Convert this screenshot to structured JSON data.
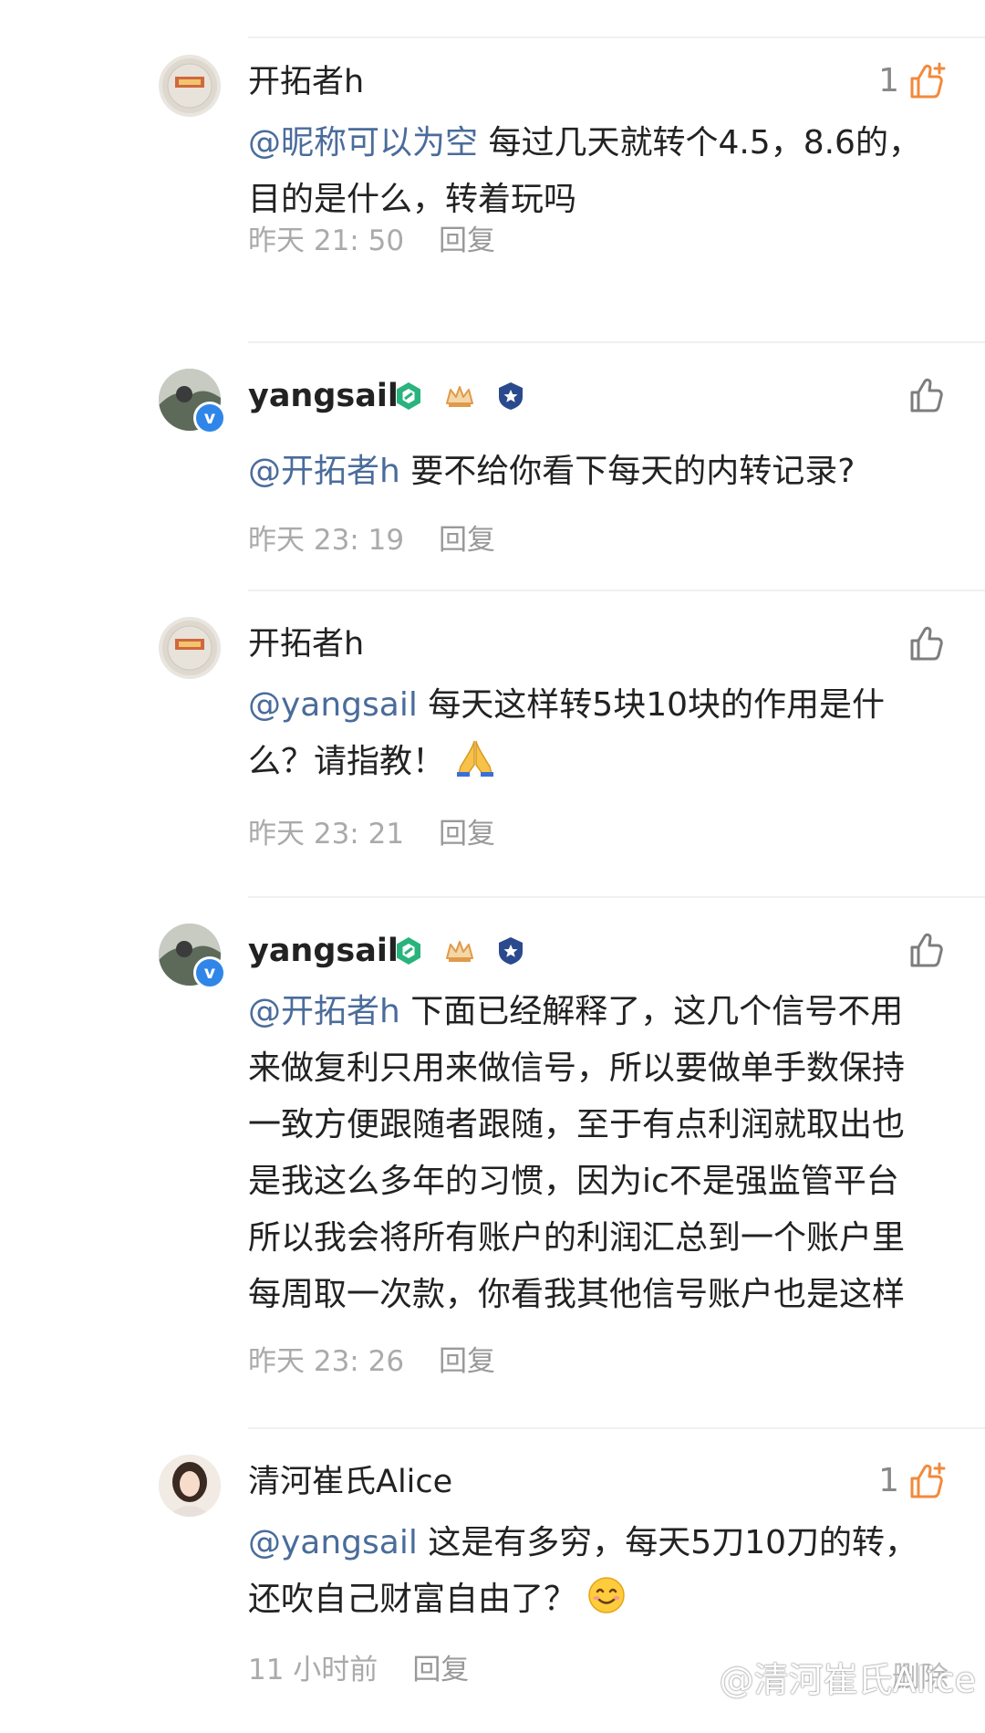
{
  "comments": [
    {
      "username": "开拓者h",
      "like_count": "1",
      "mention": "@昵称可以为空",
      "text_lines": [
        " 每过几天就转个4.5，8.6的，",
        "目的是什么，转着玩吗"
      ],
      "time": "昨天 21: 50",
      "reply_label": "回复"
    },
    {
      "username": "yangsail",
      "like_count": "",
      "mention": "@开拓者h",
      "text_lines": [
        " 要不给你看下每天的内转记录?"
      ],
      "time": "昨天 23: 19",
      "reply_label": "回复"
    },
    {
      "username": "开拓者h",
      "like_count": "",
      "mention": "@yangsail",
      "text_lines": [
        " 每天这样转5块10块的作用是什",
        "么？请指教！"
      ],
      "time": "昨天 23: 21",
      "reply_label": "回复"
    },
    {
      "username": "yangsail",
      "like_count": "",
      "mention": "@开拓者h",
      "text_lines": [
        " 下面已经解释了，这几个信号不用",
        "来做复利只用来做信号，所以要做单手数保持",
        "一致方便跟随者跟随，至于有点利润就取出也",
        "是我这么多年的习惯，因为ic不是强监管平台",
        "所以我会将所有账户的利润汇总到一个账户里",
        "每周取一次款，你看我其他信号账户也是这样"
      ],
      "time": "昨天 23: 26",
      "reply_label": "回复"
    },
    {
      "username": "清河崔氏Alice",
      "like_count": "1",
      "mention": "@yangsail",
      "text_lines": [
        " 这是有多穷，每天5刀10刀的转，",
        "还吹自己财富自由了？"
      ],
      "time": "11 小时前",
      "reply_label": "回复",
      "delete_label": "删除"
    }
  ],
  "icons": {
    "like": "thumbs-up-outline-icon",
    "liked": "thumbs-up-plus-icon",
    "verified": "verified-v-icon",
    "badge_green": "green-hexagon-badge-icon",
    "badge_crown": "crown-badge-icon",
    "badge_shield": "shield-badge-icon",
    "emoji_pray": "praying-hands-emoji",
    "emoji_smile": "smiling-face-emoji"
  },
  "watermark": "@清河崔氏Alice",
  "colors": {
    "mention": "#4a6c9b",
    "liked": "#f28a3c",
    "meta": "#aaaaaa",
    "verified": "#2f86e8"
  }
}
